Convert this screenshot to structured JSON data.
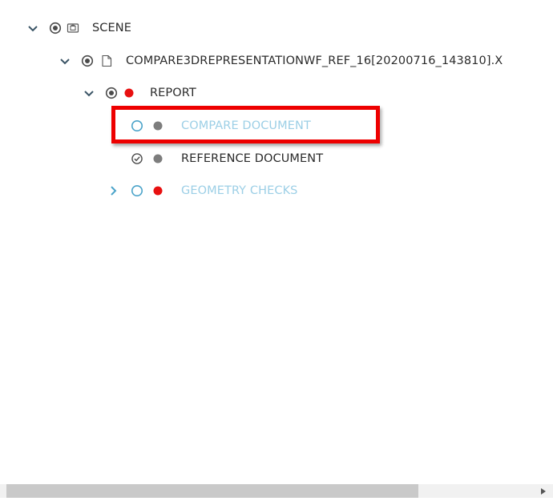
{
  "tree": {
    "scene": {
      "label": "SCENE"
    },
    "file": {
      "label": "COMPARE3DREPRESENTATIONWF_REF_16[20200716_143810].X"
    },
    "report": {
      "label": "REPORT"
    },
    "compare_document": {
      "label": "COMPARE DOCUMENT"
    },
    "reference_document": {
      "label": "REFERENCE DOCUMENT"
    },
    "geometry_checks": {
      "label": "GEOMETRY CHECKS"
    }
  },
  "colors": {
    "accent_blue": "#4aa3c9",
    "muted_text": "#9ccfe6",
    "status_red": "#e81010",
    "status_gray": "#7d7d7d",
    "highlight": "#ee0000"
  }
}
